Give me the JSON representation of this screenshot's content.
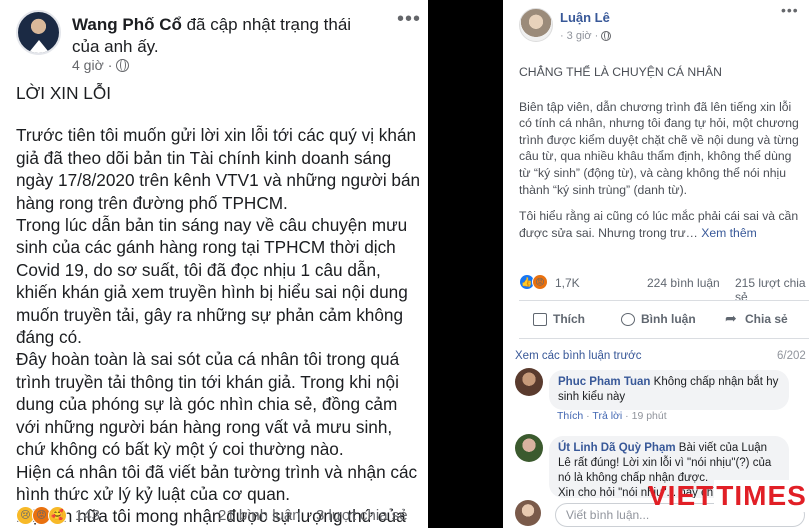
{
  "left_post": {
    "author": "Wang Phố Cổ",
    "status": "đã cập nhật trạng thái của anh ấy.",
    "time": "4 giờ",
    "title": "LỜI XIN LỖI",
    "paragraphs": [
      "Trước tiên tôi muốn gửi lời xin lỗi tới các quý vị khán giả đã theo dõi bản tin Tài chính kinh doanh sáng ngày 17/8/2020 trên kênh VTV1 và những người bán hàng rong trên đường phố TPHCM.",
      "Trong lúc dẫn bản tin sáng nay về câu chuyện mưu sinh của các gánh hàng rong tại TPHCM thời dịch Covid 19, do sơ suất, tôi đã đọc nhịu 1 câu dẫn, khiến khán giả xem truyền hình bị hiểu sai nội dung muốn truyền tải, gây ra những sự phản cảm không đáng có.",
      "Đây hoàn toàn là sai sót của cá nhân tôi trong quá trình truyền tải thông tin tới khán giả. Trong khi nội dung của phóng sự là góc nhìn chia sẻ, đồng cảm với những người bán hàng rong vất vả mưu sinh, chứ không có bất kỳ một ý coi thường nào.",
      "Hiện cá nhân tôi đã viết bản tường trình và nhận các hình thức xử lý kỷ luật của cơ quan.",
      "Một lần nữa tôi mong nhận được sự lượng thứ của quý vị khán giả."
    ],
    "reaction_count": "143",
    "comments": "21 bình luận",
    "shares": "3 lượt chia sẻ"
  },
  "right_post": {
    "author": "Luận Lê",
    "time": "3 giờ",
    "title": "CHẲNG THỂ LÀ CHUYỆN CÁ NHÂN",
    "paragraph1": "Biên tập viên, dẫn chương trình đã lên tiếng xin lỗi có tính cá nhân, nhưng tôi đang tự hỏi, một chương trình được kiểm duyệt chặt chẽ về nội dung và từng câu từ, qua nhiều khâu thẩm định, không thể dùng từ “ký sinh” (động từ), và càng không thể nói nhịu thành “ký sinh trùng” (danh từ).",
    "paragraph2": "Tôi hiểu rằng ai cũng có lúc mắc phải cái sai và cần được sửa sai. Nhưng trong trư…",
    "see_more": "Xem thêm",
    "reaction_count": "1,7K",
    "comments": "224 bình luận",
    "shares": "215 lượt chia sẻ",
    "like_label": "Thích",
    "comment_label": "Bình luận",
    "share_label": "Chia sẻ",
    "prev_comments": "Xem các bình luận trước",
    "pagination": "6/202",
    "comment1": {
      "name": "Phuc Pham Tuan",
      "text": "Không chấp nhận bắt hy sinh kiểu này",
      "like": "Thích",
      "reply": "Trả lời",
      "time": "19 phút"
    },
    "comment2": {
      "name": "Út Linh Dã Quỳ Phạm",
      "text": "Bài viết của Luận Lê rất đúng! Lời xin lỗi vì \"nói nhịu\"(?) của nó là không chấp nhận được.",
      "text2": "Xin cho hỏi \"nói nhịu\"... nay chỉ"
    },
    "input_placeholder": "Viết bình luận..."
  },
  "watermark": {
    "part1": "VIET",
    "part2": "TIMES"
  },
  "icons": [
    "more-horizontal-icon",
    "globe-icon",
    "like-icon",
    "comment-icon",
    "share-icon"
  ]
}
